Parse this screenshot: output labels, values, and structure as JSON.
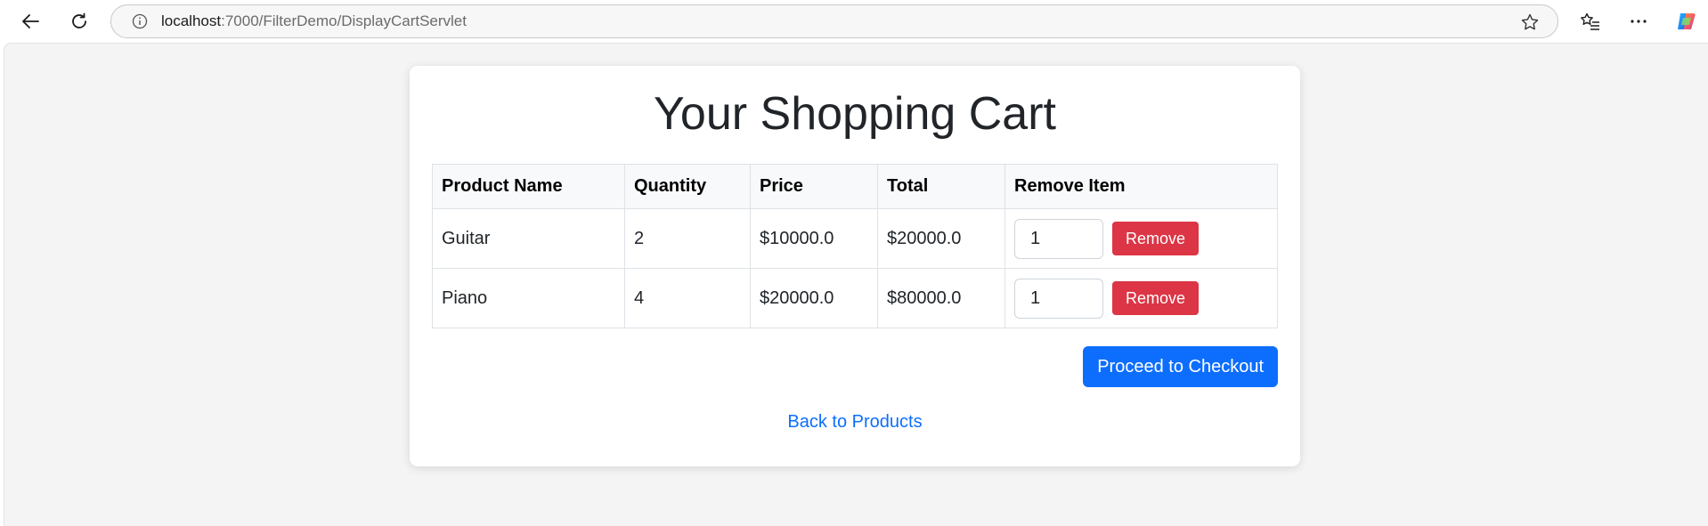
{
  "browser": {
    "back_icon": "back-arrow-icon",
    "refresh_icon": "refresh-icon",
    "info_icon": "info-icon",
    "url_host": "localhost",
    "url_path": ":7000/FilterDemo/DisplayCartServlet",
    "favorite_icon": "star-icon",
    "favorites_icon": "favorites-list-icon",
    "more_icon": "more-icon",
    "copilot_icon": "copilot-icon"
  },
  "page": {
    "title": "Your Shopping Cart",
    "table": {
      "headers": [
        "Product Name",
        "Quantity",
        "Price",
        "Total",
        "Remove Item"
      ],
      "rows": [
        {
          "product": "Guitar",
          "quantity": "2",
          "price": "$10000.0",
          "total": "$20000.0",
          "remove_qty": "1",
          "remove_label": "Remove"
        },
        {
          "product": "Piano",
          "quantity": "4",
          "price": "$20000.0",
          "total": "$80000.0",
          "remove_qty": "1",
          "remove_label": "Remove"
        }
      ]
    },
    "checkout_label": "Proceed to Checkout",
    "back_label": "Back to Products"
  },
  "colors": {
    "remove_button": "#dc3545",
    "checkout_button": "#0d6efd",
    "link": "#0d6efd"
  }
}
